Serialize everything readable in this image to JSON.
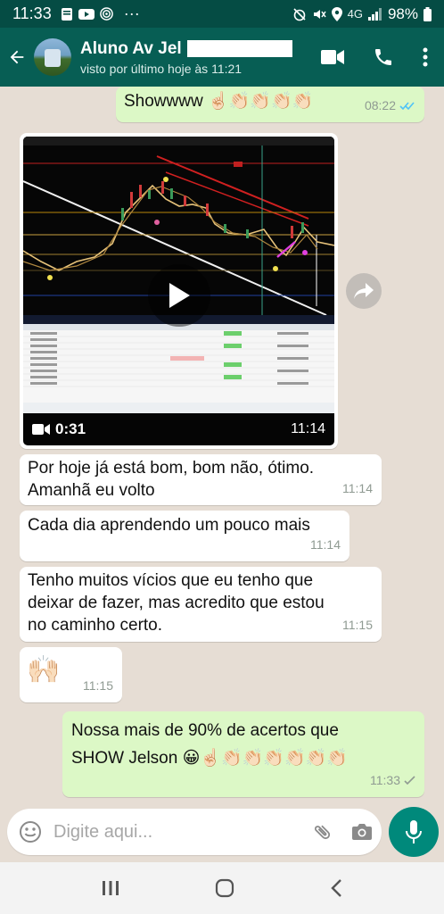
{
  "status_bar": {
    "time": "11:33",
    "battery": "98%",
    "network": "4G"
  },
  "header": {
    "contact_name": "Aluno Av Jel",
    "last_seen": "visto por último hoje às 11:21"
  },
  "messages": [
    {
      "id": "m0",
      "direction": "outgoing",
      "text": "Showwww ☝🏻👏🏻👏🏻👏🏻👏🏻",
      "time": "08:22",
      "status": "read"
    },
    {
      "id": "m1",
      "direction": "incoming",
      "type": "video",
      "duration": "0:31",
      "time": "11:14"
    },
    {
      "id": "m2",
      "direction": "incoming",
      "text_lines": [
        "Por hoje já está bom, bom não, ótimo.",
        "Amanhã eu volto"
      ],
      "time": "11:14"
    },
    {
      "id": "m3",
      "direction": "incoming",
      "text": "Cada dia aprendendo um pouco mais",
      "time": "11:14"
    },
    {
      "id": "m4",
      "direction": "incoming",
      "text_lines": [
        "Tenho muitos vícios que eu tenho que",
        "deixar de fazer, mas acredito que estou",
        "no caminho certo."
      ],
      "time": "11:15"
    },
    {
      "id": "m5",
      "direction": "incoming",
      "text": "🙌🏻",
      "time": "11:15"
    },
    {
      "id": "m6",
      "direction": "outgoing",
      "text_lines": [
        "Nossa mais de 90% de acertos que",
        "SHOW Jelson 😀☝🏻👏🏻👏🏻👏🏻👏🏻👏🏻👏🏻"
      ],
      "time": "11:33",
      "status": "sent"
    }
  ],
  "composer": {
    "placeholder": "Digite aqui..."
  },
  "icons": {
    "back": "arrow-left-icon",
    "video_call": "video-camera-icon",
    "call": "phone-icon",
    "menu": "more-vert-icon",
    "emoji": "smiley-icon",
    "attach": "paperclip-icon",
    "camera": "camera-icon",
    "mic": "microphone-icon",
    "forward": "forward-icon"
  },
  "colors": {
    "header": "#075e54",
    "status_bar": "#054c44",
    "outgoing_bubble": "#dcf8c6",
    "incoming_bubble": "#ffffff",
    "read_tick": "#4fc3f7",
    "mic_button": "#00897b"
  }
}
